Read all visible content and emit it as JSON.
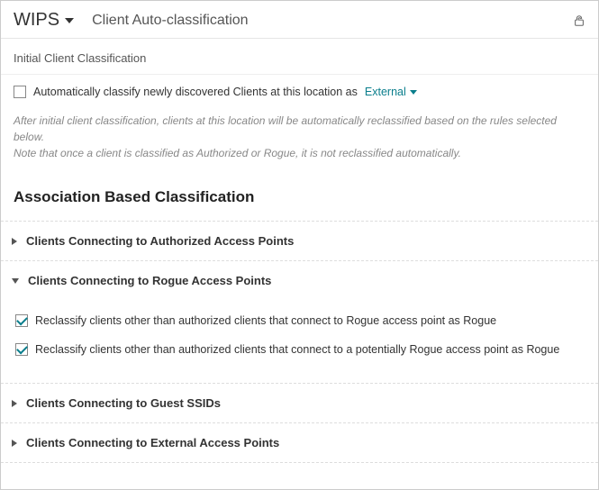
{
  "header": {
    "dropdown_label": "WIPS",
    "page_title": "Client Auto-classification"
  },
  "initial": {
    "section_label": "Initial Client Classification",
    "auto_classify_label": "Automatically classify newly discovered Clients at this location as",
    "auto_classify_value": "External",
    "auto_classify_checked": false,
    "hint_line1": "After initial client classification, clients at this location will be automatically reclassified based on the rules selected below.",
    "hint_line2": "Note that once a client is classified as Authorized or Rogue, it is not reclassified automatically."
  },
  "assoc": {
    "heading": "Association Based Classification",
    "items": [
      {
        "title": "Clients Connecting to Authorized Access Points",
        "expanded": false
      },
      {
        "title": "Clients Connecting to Rogue Access Points",
        "expanded": true,
        "options": [
          {
            "label": "Reclassify clients other than authorized clients that connect to Rogue access point as Rogue",
            "checked": true
          },
          {
            "label": "Reclassify clients other than authorized clients that connect to a potentially Rogue access point as Rogue",
            "checked": true
          }
        ]
      },
      {
        "title": "Clients Connecting to Guest SSIDs",
        "expanded": false
      },
      {
        "title": "Clients Connecting to External Access Points",
        "expanded": false
      }
    ]
  }
}
